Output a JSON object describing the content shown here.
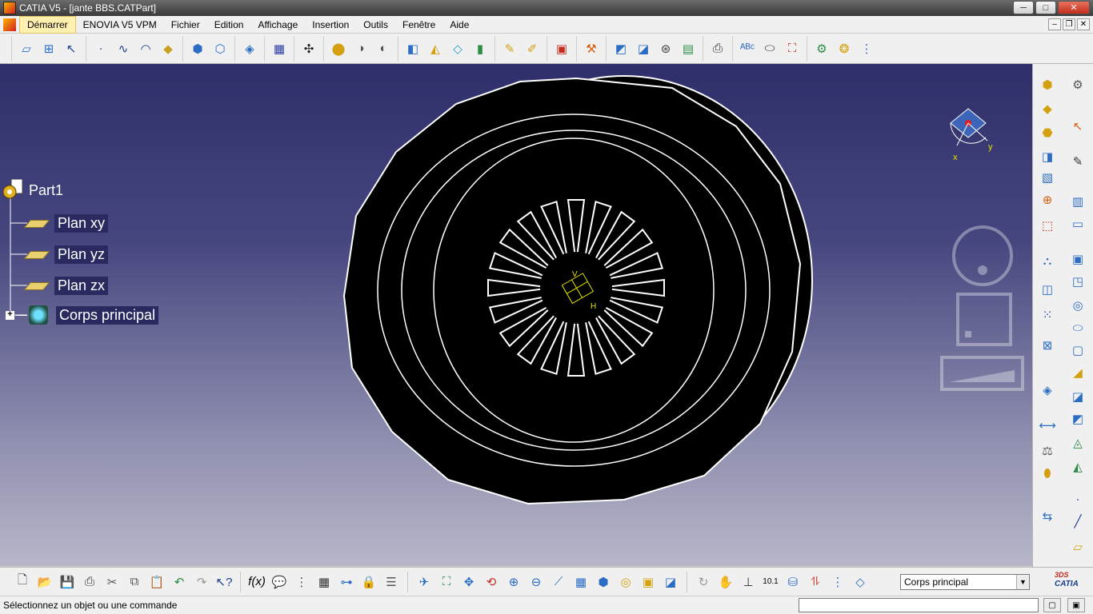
{
  "window": {
    "title": "CATIA V5 - [jante BBS.CATPart]",
    "minimize": "─",
    "maximize": "□",
    "close": "✕"
  },
  "menubar": {
    "items": [
      "Démarrer",
      "ENOVIA V5 VPM",
      "Fichier",
      "Edition",
      "Affichage",
      "Insertion",
      "Outils",
      "Fenêtre",
      "Aide"
    ],
    "mdi_minimize": "–",
    "mdi_restore": "❐",
    "mdi_close": "✕"
  },
  "tree": {
    "root": "Part1",
    "children": [
      "Plan xy",
      "Plan yz",
      "Plan zx",
      "Corps principal"
    ],
    "expander": "+"
  },
  "compass": {
    "x": "x",
    "y": "y"
  },
  "axis": {
    "v": "V",
    "h": "H"
  },
  "bottom_toolbar": {
    "current_body": "Corps principal",
    "combo_arrow": "▼",
    "logo_text": "CATIA",
    "logo_prefix": "3DS"
  },
  "statusbar": {
    "message": "Sélectionnez un objet ou une commande"
  },
  "colors": {
    "viewport_top": "#2e2e6a",
    "viewport_bottom": "#b7b7c9",
    "wheel_fill": "#000000",
    "wheel_edge": "#ffffff",
    "axis_color": "#e6e600"
  },
  "icons": {
    "top_toolbar": [
      "sketch-icon",
      "positioned-sketch-icon",
      "help-pointer-icon",
      "point-icon",
      "spline-icon",
      "circle-icon",
      "plane-icon",
      "pad-icon",
      "pocket-icon",
      "shaft-icon",
      "chamfer-icon",
      "hole-icon",
      "rib-icon",
      "solid-icon",
      "sweep-icon",
      "draft-icon",
      "loft-icon",
      "split-icon",
      "thickness-icon",
      "body-icon",
      "edge-fillet-icon",
      "transform-icon",
      "mirror-icon",
      "pattern-icon",
      "scale-icon",
      "measure-icon",
      "apply-material-icon",
      "constraint-icon",
      "analysis-icon",
      "camera-icon",
      "text-icon",
      "annotation-icon",
      "tools-icon",
      "catalog-icon",
      "knowledge-icon"
    ],
    "bottom_toolbar": [
      "new-icon",
      "open-icon",
      "save-icon",
      "print-icon",
      "cut-icon",
      "copy-icon",
      "paste-icon",
      "undo-icon",
      "redo-icon",
      "whats-this-icon",
      "formula-icon",
      "comment-icon",
      "design-table-icon",
      "table-icon",
      "knowledge-icon",
      "fly-icon",
      "fit-all-icon",
      "pan-icon",
      "rotate-icon",
      "zoom-in-icon",
      "zoom-out-icon",
      "normal-view-icon",
      "quick-view-icon",
      "views-icon",
      "render-style-icon",
      "hide-show-icon",
      "swap-space-icon",
      "update-icon",
      "manipulate-icon",
      "axis-system-icon",
      "units-icon",
      "3d-annotation-icon",
      "scan-icon",
      "list-icon",
      "define-body-icon"
    ]
  }
}
